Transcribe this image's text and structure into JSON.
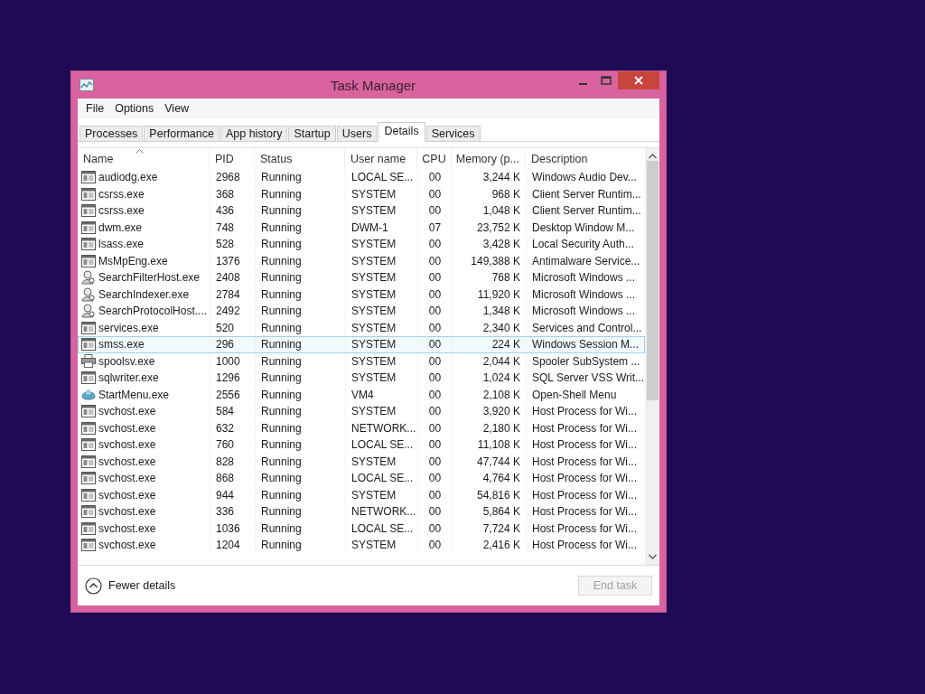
{
  "window": {
    "title": "Task Manager"
  },
  "menu": [
    "File",
    "Options",
    "View"
  ],
  "tabs": [
    {
      "label": "Processes",
      "selected": false
    },
    {
      "label": "Performance",
      "selected": false
    },
    {
      "label": "App history",
      "selected": false
    },
    {
      "label": "Startup",
      "selected": false
    },
    {
      "label": "Users",
      "selected": false
    },
    {
      "label": "Details",
      "selected": true
    },
    {
      "label": "Services",
      "selected": false
    }
  ],
  "table": {
    "columns": [
      {
        "label": "Name",
        "sorted": true
      },
      {
        "label": "PID",
        "sorted": false
      },
      {
        "label": "Status",
        "sorted": false
      },
      {
        "label": "User name",
        "sorted": false
      },
      {
        "label": "CPU",
        "sorted": false
      },
      {
        "label": "Memory (p...",
        "sorted": false
      },
      {
        "label": "Description",
        "sorted": false
      }
    ],
    "rows": [
      {
        "kind": "app",
        "name": "audiodg.exe",
        "pid": "2968",
        "status": "Running",
        "user": "LOCAL SE...",
        "cpu": "00",
        "memory": "3,244 K",
        "description": "Windows Audio Dev...",
        "selected": false
      },
      {
        "kind": "app",
        "name": "csrss.exe",
        "pid": "368",
        "status": "Running",
        "user": "SYSTEM",
        "cpu": "00",
        "memory": "968 K",
        "description": "Client Server Runtim...",
        "selected": false
      },
      {
        "kind": "app",
        "name": "csrss.exe",
        "pid": "436",
        "status": "Running",
        "user": "SYSTEM",
        "cpu": "00",
        "memory": "1,048 K",
        "description": "Client Server Runtim...",
        "selected": false
      },
      {
        "kind": "app",
        "name": "dwm.exe",
        "pid": "748",
        "status": "Running",
        "user": "DWM-1",
        "cpu": "07",
        "memory": "23,752 K",
        "description": "Desktop Window M...",
        "selected": false
      },
      {
        "kind": "app",
        "name": "lsass.exe",
        "pid": "528",
        "status": "Running",
        "user": "SYSTEM",
        "cpu": "00",
        "memory": "3,428 K",
        "description": "Local Security Auth...",
        "selected": false
      },
      {
        "kind": "app",
        "name": "MsMpEng.exe",
        "pid": "1376",
        "status": "Running",
        "user": "SYSTEM",
        "cpu": "00",
        "memory": "149,388 K",
        "description": "Antimalware Service...",
        "selected": false
      },
      {
        "kind": "search",
        "name": "SearchFilterHost.exe",
        "pid": "2408",
        "status": "Running",
        "user": "SYSTEM",
        "cpu": "00",
        "memory": "768 K",
        "description": "Microsoft Windows ...",
        "selected": false
      },
      {
        "kind": "search",
        "name": "SearchIndexer.exe",
        "pid": "2784",
        "status": "Running",
        "user": "SYSTEM",
        "cpu": "00",
        "memory": "11,920 K",
        "description": "Microsoft Windows ...",
        "selected": false
      },
      {
        "kind": "search",
        "name": "SearchProtocolHost....",
        "pid": "2492",
        "status": "Running",
        "user": "SYSTEM",
        "cpu": "00",
        "memory": "1,348 K",
        "description": "Microsoft Windows ...",
        "selected": false
      },
      {
        "kind": "app",
        "name": "services.exe",
        "pid": "520",
        "status": "Running",
        "user": "SYSTEM",
        "cpu": "00",
        "memory": "2,340 K",
        "description": "Services and Control...",
        "selected": false
      },
      {
        "kind": "app",
        "name": "smss.exe",
        "pid": "296",
        "status": "Running",
        "user": "SYSTEM",
        "cpu": "00",
        "memory": "224 K",
        "description": "Windows Session M...",
        "selected": true
      },
      {
        "kind": "printer",
        "name": "spoolsv.exe",
        "pid": "1000",
        "status": "Running",
        "user": "SYSTEM",
        "cpu": "00",
        "memory": "2,044 K",
        "description": "Spooler SubSystem ...",
        "selected": false
      },
      {
        "kind": "app",
        "name": "sqlwriter.exe",
        "pid": "1296",
        "status": "Running",
        "user": "SYSTEM",
        "cpu": "00",
        "memory": "1,024 K",
        "description": "SQL Server VSS Writ...",
        "selected": false
      },
      {
        "kind": "shell",
        "name": "StartMenu.exe",
        "pid": "2556",
        "status": "Running",
        "user": "VM4",
        "cpu": "00",
        "memory": "2,108 K",
        "description": "Open-Shell Menu",
        "selected": false
      },
      {
        "kind": "app",
        "name": "svchost.exe",
        "pid": "584",
        "status": "Running",
        "user": "SYSTEM",
        "cpu": "00",
        "memory": "3,920 K",
        "description": "Host Process for Wi...",
        "selected": false
      },
      {
        "kind": "app",
        "name": "svchost.exe",
        "pid": "632",
        "status": "Running",
        "user": "NETWORK...",
        "cpu": "00",
        "memory": "2,180 K",
        "description": "Host Process for Wi...",
        "selected": false
      },
      {
        "kind": "app",
        "name": "svchost.exe",
        "pid": "760",
        "status": "Running",
        "user": "LOCAL SE...",
        "cpu": "00",
        "memory": "11,108 K",
        "description": "Host Process for Wi...",
        "selected": false
      },
      {
        "kind": "app",
        "name": "svchost.exe",
        "pid": "828",
        "status": "Running",
        "user": "SYSTEM",
        "cpu": "00",
        "memory": "47,744 K",
        "description": "Host Process for Wi...",
        "selected": false
      },
      {
        "kind": "app",
        "name": "svchost.exe",
        "pid": "868",
        "status": "Running",
        "user": "LOCAL SE...",
        "cpu": "00",
        "memory": "4,764 K",
        "description": "Host Process for Wi...",
        "selected": false
      },
      {
        "kind": "app",
        "name": "svchost.exe",
        "pid": "944",
        "status": "Running",
        "user": "SYSTEM",
        "cpu": "00",
        "memory": "54,816 K",
        "description": "Host Process for Wi...",
        "selected": false
      },
      {
        "kind": "app",
        "name": "svchost.exe",
        "pid": "336",
        "status": "Running",
        "user": "NETWORK...",
        "cpu": "00",
        "memory": "5,864 K",
        "description": "Host Process for Wi...",
        "selected": false
      },
      {
        "kind": "app",
        "name": "svchost.exe",
        "pid": "1036",
        "status": "Running",
        "user": "LOCAL SE...",
        "cpu": "00",
        "memory": "7,724 K",
        "description": "Host Process for Wi...",
        "selected": false
      },
      {
        "kind": "app",
        "name": "svchost.exe",
        "pid": "1204",
        "status": "Running",
        "user": "SYSTEM",
        "cpu": "00",
        "memory": "2,416 K",
        "description": "Host Process for Wi...",
        "selected": false
      }
    ]
  },
  "footer": {
    "toggle": "Fewer details",
    "button": {
      "label": "End task",
      "disabled": true
    }
  }
}
